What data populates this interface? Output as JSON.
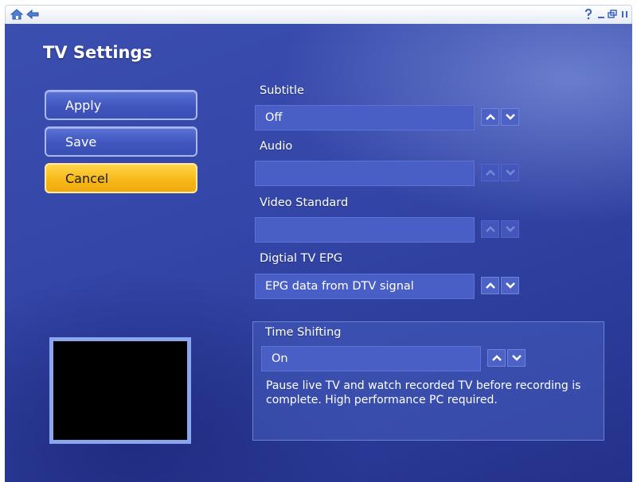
{
  "page": {
    "title": "TV Settings"
  },
  "titlebar": {
    "icons": [
      "home-icon",
      "back-icon",
      "help-icon",
      "minimize-icon",
      "restore-icon",
      "close-icon"
    ]
  },
  "actions": {
    "apply": "Apply",
    "save": "Save",
    "cancel": "Cancel"
  },
  "fields": {
    "subtitle": {
      "label": "Subtitle",
      "value": "Off",
      "enabled": true
    },
    "audio": {
      "label": "Audio",
      "value": "",
      "enabled": false
    },
    "video_standard": {
      "label": "Video Standard",
      "value": "",
      "enabled": false
    },
    "epg": {
      "label": "Digtial TV EPG",
      "value": "EPG data from DTV signal",
      "enabled": true
    }
  },
  "time_shifting": {
    "label": "Time Shifting",
    "value": "On",
    "description": "Pause live TV and watch recorded TV before recording is complete. High performance PC required."
  },
  "colors": {
    "background": "#3446a8",
    "focus": "#f7b91a",
    "button": "#4a62cc"
  }
}
